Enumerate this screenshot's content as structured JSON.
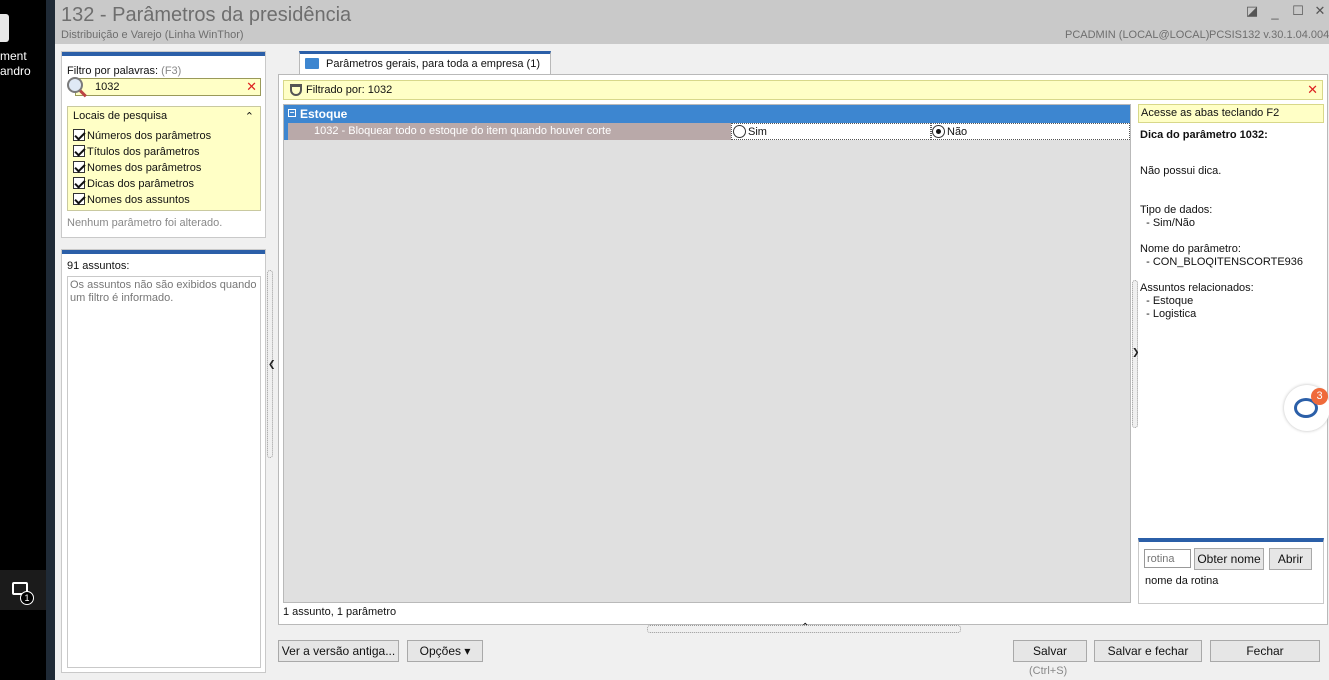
{
  "desktop": {
    "label": "ment\nandro",
    "notif_badge": "1"
  },
  "window": {
    "title": "132 - Parâmetros da presidência",
    "subtitle": "Distribuição e Varejo (Linha WinThor)",
    "user": "PCADMIN (LOCAL@LOCAL)",
    "version": "PCSIS132  v.30.1.04.004"
  },
  "filter": {
    "label": "Filtro por palavras:",
    "hint": "(F3)",
    "value": "1032",
    "locais_title": "Locais de pesquisa",
    "options": [
      {
        "label": "Números dos parâmetros",
        "checked": true
      },
      {
        "label": "Títulos dos parâmetros",
        "checked": true
      },
      {
        "label": "Nomes dos parâmetros",
        "checked": true
      },
      {
        "label": "Dicas dos parâmetros",
        "checked": true
      },
      {
        "label": "Nomes dos assuntos",
        "checked": true
      }
    ],
    "no_change": "Nenhum parâmetro foi alterado."
  },
  "assuntos": {
    "count_label": "91 assuntos:",
    "message": "Os assuntos não são exibidos quando um filtro é informado."
  },
  "tab": {
    "label": "Parâmetros gerais, para toda a empresa  (1)"
  },
  "filterbar": {
    "text": "Filtrado por: 1032"
  },
  "grid": {
    "group": "Estoque",
    "row": {
      "label": "1032 - Bloquear todo o estoque do item quando houver corte",
      "option_yes": "Sim",
      "option_no": "Não",
      "selected": "Não"
    },
    "status": "1 assunto, 1 parâmetro"
  },
  "right_panel": {
    "tip": "Acesse as abas teclando F2",
    "dica_title": "Dica do parâmetro 1032:",
    "dica_text": "Não possui dica.",
    "tipo_label": "Tipo de dados:",
    "tipo_value": "  - Sim/Não",
    "nome_label": "Nome do parâmetro:",
    "nome_value": "  - CON_BLOQITENSCORTE936",
    "assuntos_label": "Assuntos relacionados:",
    "assuntos_values": "  - Estoque\n  - Logistica",
    "chat_badge": "3"
  },
  "rotina": {
    "placeholder": "rotina",
    "obter_label": "Obter nome",
    "abrir_label": "Abrir",
    "name_label": "nome da rotina"
  },
  "footer": {
    "old_version": "Ver a versão antiga...",
    "options": "Opções ▾",
    "save": "Salvar",
    "save_hint": "(Ctrl+S)",
    "save_close": "Salvar e fechar",
    "close": "Fechar"
  },
  "colors": {
    "accent": "#2b5fa8",
    "group_header": "#3d86d0",
    "highlight_yellow": "#ffffc6"
  }
}
